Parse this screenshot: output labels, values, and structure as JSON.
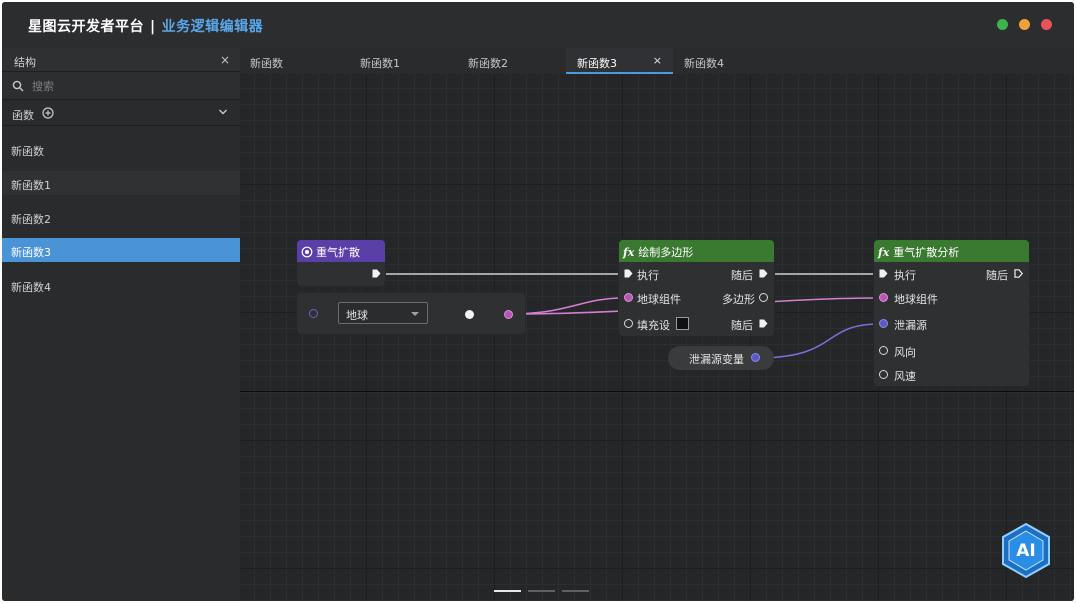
{
  "window": {
    "app_title": "星图云开发者平台",
    "separator": "|",
    "subtitle": "业务逻辑编辑器",
    "controls": [
      {
        "name": "maximize",
        "color": "#3fb24d"
      },
      {
        "name": "minimize",
        "color": "#f0a23a"
      },
      {
        "name": "close",
        "color": "#e9525a"
      }
    ]
  },
  "sidebar": {
    "header_label": "结构",
    "close_glyph": "×",
    "search_placeholder": "搜索",
    "section_label": "函数",
    "functions": [
      {
        "label": "新函数",
        "selected": false
      },
      {
        "label": "新函数1",
        "selected": false
      },
      {
        "label": "新函数2",
        "selected": false
      },
      {
        "label": "新函数3",
        "selected": true
      },
      {
        "label": "新函数4",
        "selected": false
      }
    ]
  },
  "tabs": [
    {
      "label": "新函数",
      "active": false
    },
    {
      "label": "新函数1",
      "active": false
    },
    {
      "label": "新函数2",
      "active": false
    },
    {
      "label": "新函数3",
      "active": true,
      "close_glyph": "×"
    },
    {
      "label": "新函数4",
      "active": false
    }
  ],
  "canvas": {
    "event_node": {
      "title": "重气扩散"
    },
    "planet_selector": {
      "value": "地球"
    },
    "draw_polygon_node": {
      "title": "绘制多边形",
      "fx_glyph": "fx",
      "exec_in": "执行",
      "exec_out": "随后",
      "input_planet": "地球组件",
      "output_polygon": "多边形",
      "input_fill": "填充设",
      "exec_out2": "随后"
    },
    "variable_node": {
      "label": "泄漏源变量"
    },
    "analysis_node": {
      "title": "重气扩散分析",
      "fx_glyph": "fx",
      "exec_in": "执行",
      "exec_out": "随后",
      "input_planet": "地球组件",
      "input_source": "泄漏源",
      "input_wind_dir": "风向",
      "input_wind_speed": "风速"
    },
    "ai_badge": "AI",
    "pager_count": 3,
    "pager_active": 0
  },
  "colors": {
    "accent_blue": "#4a9be0",
    "event_header": "#5b3fa8",
    "function_header": "#3a7a30",
    "wire_exec": "#f2f2f2",
    "wire_planet": "#d67fd2",
    "wire_source": "#7a6fd8"
  }
}
